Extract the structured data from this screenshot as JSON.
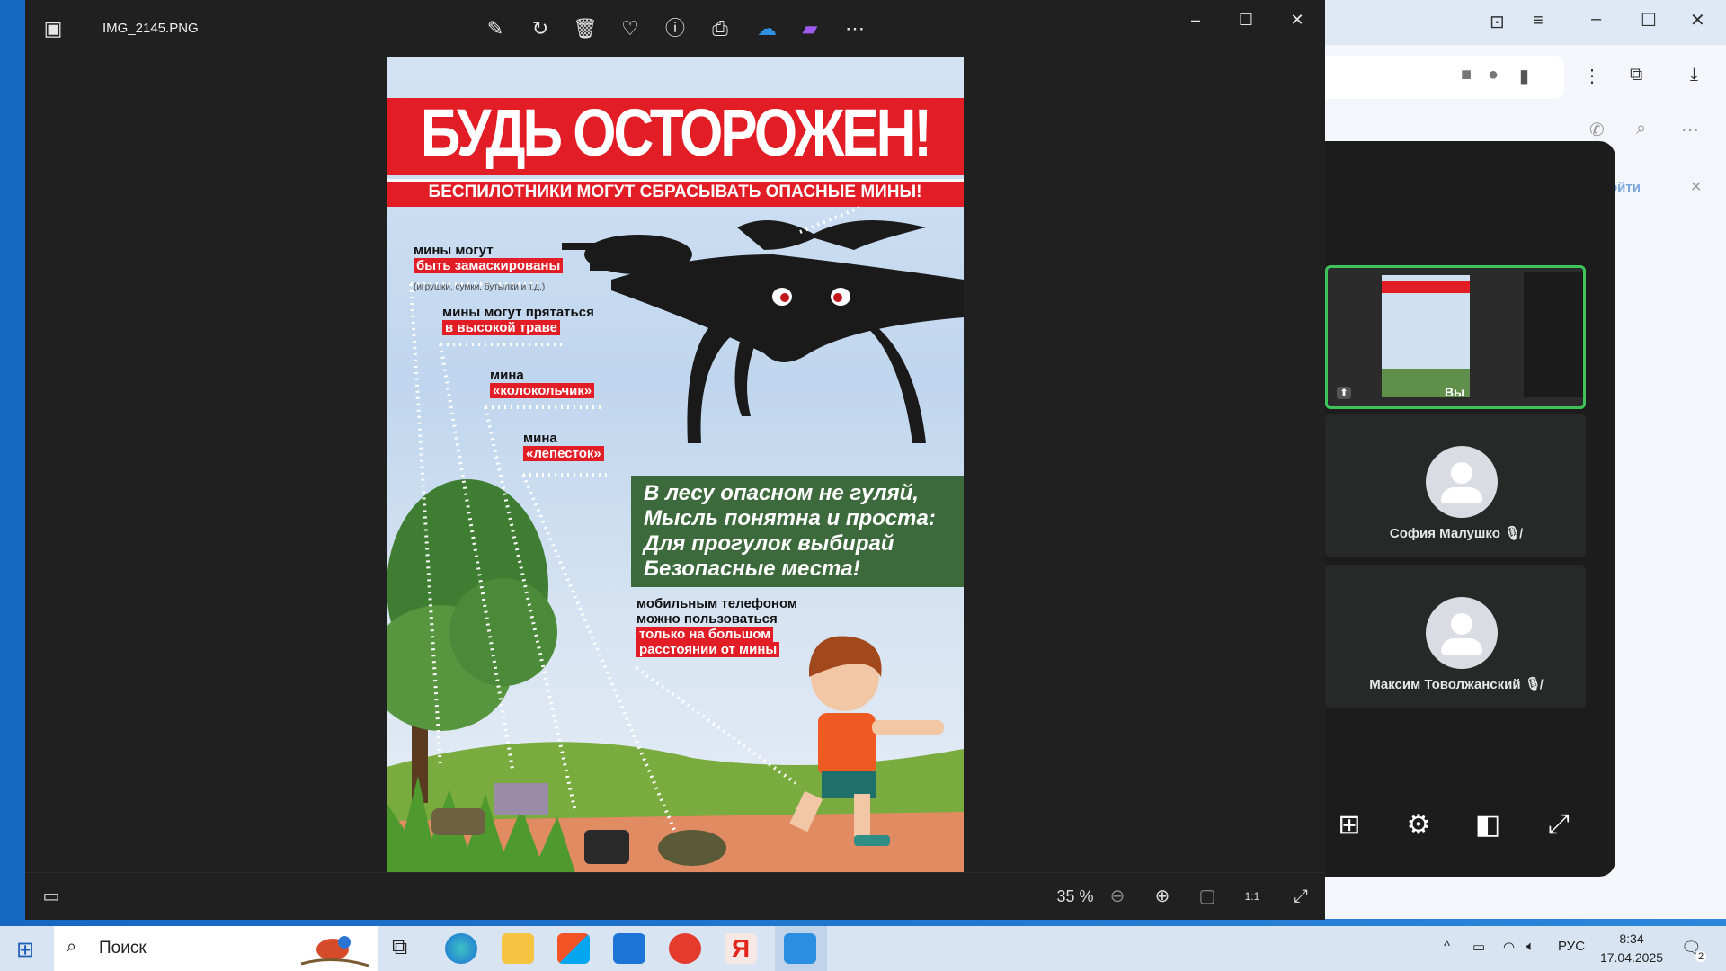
{
  "viewer": {
    "filename": "IMG_2145.PNG",
    "zoom_label": "35 %",
    "toolbar_icons": [
      "edit-icon",
      "rotate-icon",
      "delete-icon",
      "favorite-icon",
      "info-icon",
      "print-icon",
      "onedrive-icon",
      "clipchamp-icon",
      "more-icon"
    ]
  },
  "poster": {
    "headline": "БУДЬ ОСТОРОЖЕН!",
    "subheadline": "БЕСПИЛОТНИКИ МОГУТ СБРАСЫВАТЬ ОПАСНЫЕ МИНЫ!",
    "label1_line1": "мины могут",
    "label1_red": "быть замаскированы",
    "label1_note": "(игрушки, сумки, бутылки и т.д.)",
    "label2_line1": "мины могут прятаться",
    "label2_red": "в высокой траве",
    "label3_line1": "мина",
    "label3_red": "«колокольчик»",
    "label4_line1": "мина",
    "label4_red": "«лепесток»",
    "verse_lines": [
      "В лесу опасном не гуляй,",
      "Мысль понятна и проста:",
      "Для прогулок выбирай",
      "Безопасные места!"
    ],
    "phone_line1": "мобильным телефоном",
    "phone_line2": "можно пользоваться",
    "phone_red1": "только на большом",
    "phone_red2": "расстоянии от мины"
  },
  "call": {
    "self_label": "Вы",
    "participant1": "София Малушко",
    "participant2": "Максим Товолжанский",
    "browser_hint": "ойти"
  },
  "taskbar": {
    "search_placeholder": "Поиск",
    "language": "РУС",
    "time": "8:34",
    "date": "17.04.2025",
    "notifications": "2"
  }
}
